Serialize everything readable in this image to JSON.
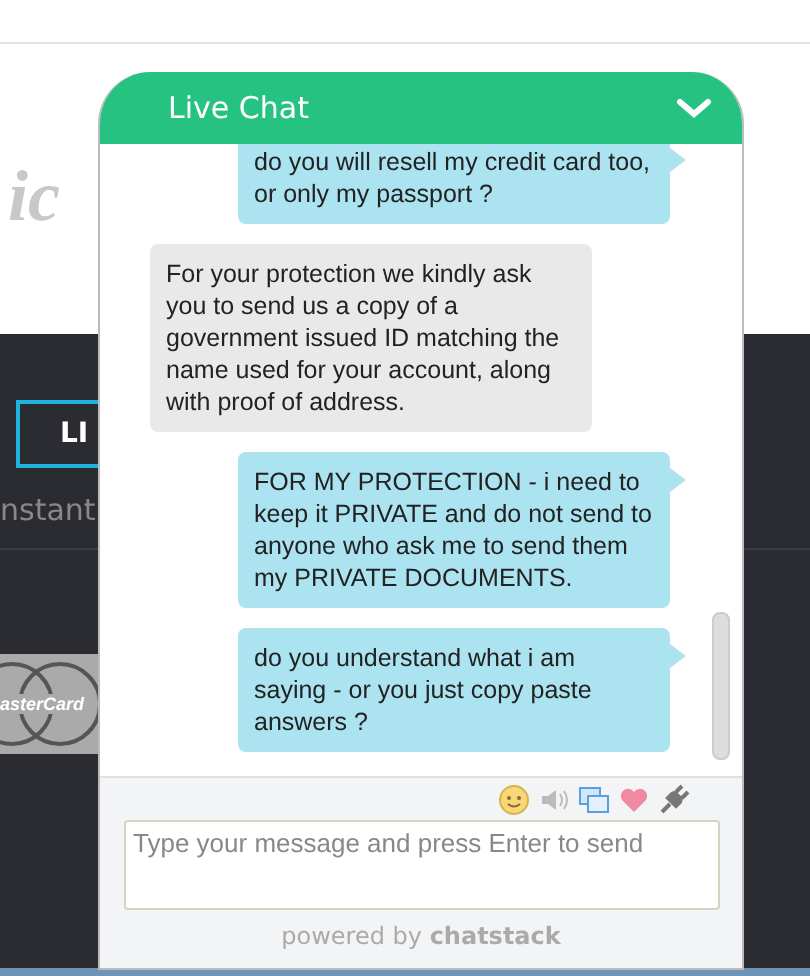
{
  "page": {
    "logo_text": "ic",
    "live_button": "LI",
    "tagline": "nstant",
    "card_logo_text": "asterCard"
  },
  "chat": {
    "title": "Live Chat",
    "messages": [
      {
        "kind": "sent",
        "text": "do you will resell my credit card too, or only my passport ?"
      },
      {
        "kind": "received",
        "text": "For your protection we kindly ask you to send us a copy of a government issued ID matching the name used for your account, along with proof of address."
      },
      {
        "kind": "sent",
        "text": "FOR MY PROTECTION - i need to keep it PRIVATE and do not send to anyone who ask me to send them my PRIVATE DOCUMENTS."
      },
      {
        "kind": "sent",
        "text": "do you understand what i am saying - or you just copy paste answers ?"
      }
    ],
    "input": {
      "placeholder": "Type your message and press Enter to send"
    },
    "footer": "powered by **chatstack**"
  }
}
